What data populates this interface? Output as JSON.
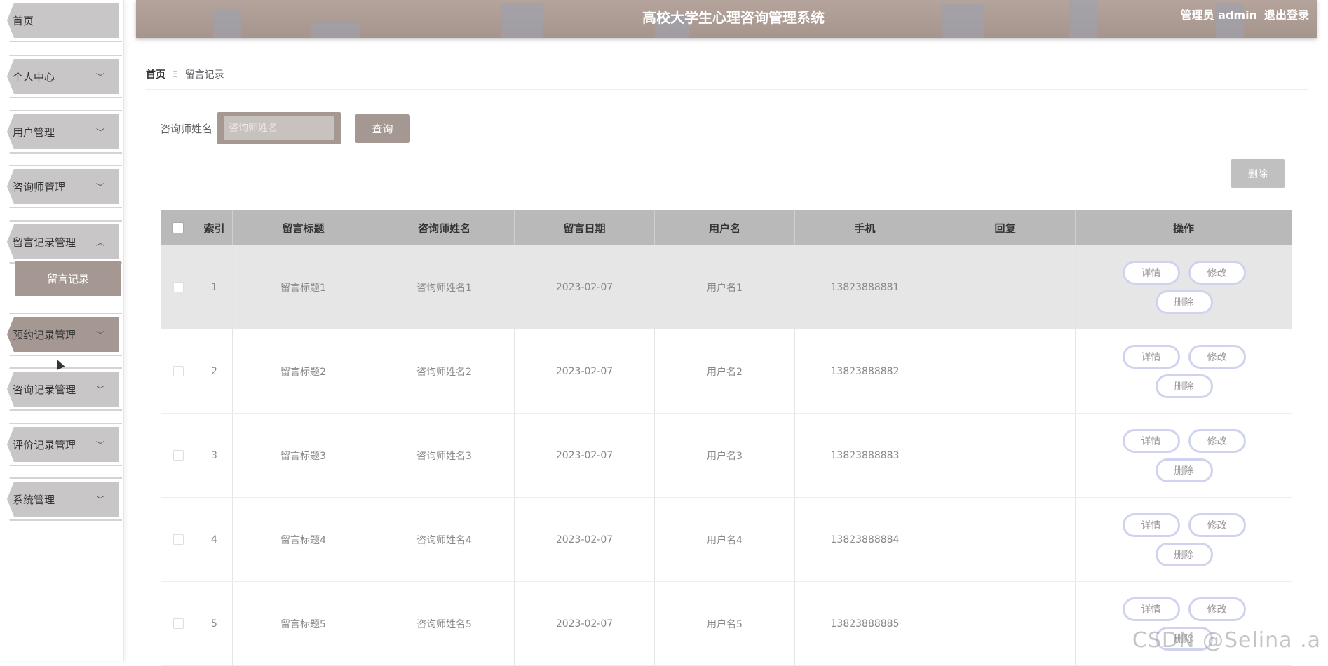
{
  "header": {
    "title": "高校大学生心理咨询管理系统",
    "user_label": "管理员 admin",
    "logout_label": "退出登录"
  },
  "sidebar": {
    "items": [
      {
        "label": "首页",
        "chevron": ""
      },
      {
        "label": "个人中心",
        "chevron": "﹀"
      },
      {
        "label": "用户管理",
        "chevron": "﹀"
      },
      {
        "label": "咨询师管理",
        "chevron": "﹀"
      },
      {
        "label": "留言记录管理",
        "chevron": "︿"
      },
      {
        "label": "预约记录管理",
        "chevron": "﹀"
      },
      {
        "label": "咨询记录管理",
        "chevron": "﹀"
      },
      {
        "label": "评价记录管理",
        "chevron": "﹀"
      },
      {
        "label": "系统管理",
        "chevron": "﹀"
      }
    ],
    "submenu_label": "留言记录"
  },
  "breadcrumb": {
    "home": "首页",
    "separator": "Ξ",
    "current": "留言记录"
  },
  "search": {
    "label": "咨询师姓名",
    "placeholder": "咨询师姓名",
    "value": "",
    "query_button": "查询"
  },
  "toolbar": {
    "delete_label": "删除"
  },
  "table": {
    "headers": {
      "index": "索引",
      "title": "留言标题",
      "counselor": "咨询师姓名",
      "date": "留言日期",
      "username": "用户名",
      "phone": "手机",
      "reply": "回复",
      "ops": "操作"
    },
    "rows": [
      {
        "index": "1",
        "title": "留言标题1",
        "counselor": "咨询师姓名1",
        "date": "2023-02-07",
        "username": "用户名1",
        "phone": "13823888881",
        "reply": ""
      },
      {
        "index": "2",
        "title": "留言标题2",
        "counselor": "咨询师姓名2",
        "date": "2023-02-07",
        "username": "用户名2",
        "phone": "13823888882",
        "reply": ""
      },
      {
        "index": "3",
        "title": "留言标题3",
        "counselor": "咨询师姓名3",
        "date": "2023-02-07",
        "username": "用户名3",
        "phone": "13823888883",
        "reply": ""
      },
      {
        "index": "4",
        "title": "留言标题4",
        "counselor": "咨询师姓名4",
        "date": "2023-02-07",
        "username": "用户名4",
        "phone": "13823888884",
        "reply": ""
      },
      {
        "index": "5",
        "title": "留言标题5",
        "counselor": "咨询师姓名5",
        "date": "2023-02-07",
        "username": "用户名5",
        "phone": "13823888885",
        "reply": ""
      }
    ],
    "ops": {
      "detail": "详情",
      "edit": "修改",
      "delete": "删除"
    }
  },
  "watermark": "CSDN @Selina .a",
  "colors": {
    "accent": "#a59892",
    "header": "#a6958d",
    "menu": "#c8c6c6",
    "table_header": "#b9b9b9"
  }
}
